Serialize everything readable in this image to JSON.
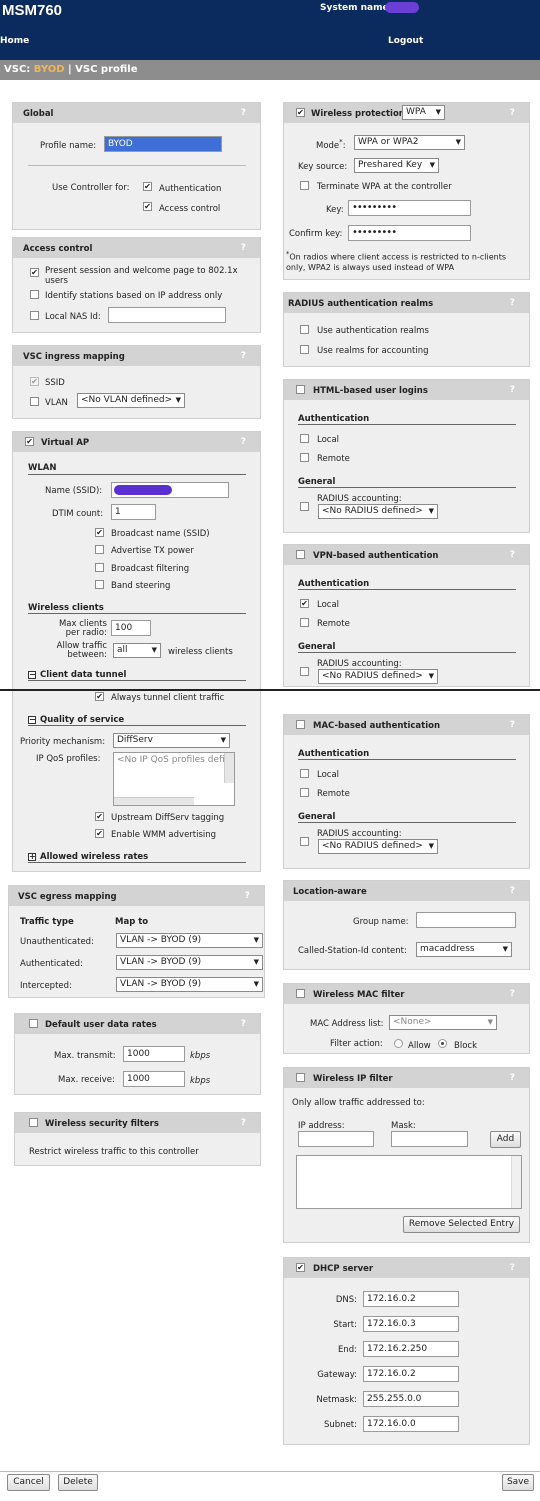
{
  "app": {
    "product": "MSM760",
    "system_name_label": "System name:"
  },
  "nav": {
    "home": "Home",
    "logout": "Logout"
  },
  "breadcrumb": {
    "prefix": "VSC: ",
    "vsc": "BYOD",
    "separator": " | ",
    "page": "VSC profile"
  },
  "global": {
    "title": "Global",
    "profile_name_label": "Profile name:",
    "profile_name": "BYOD",
    "use_controller_label": "Use Controller for:",
    "authentication": "Authentication",
    "access_control": "Access control"
  },
  "access_control": {
    "title": "Access control",
    "present_session": "Present session and welcome page to 802.1x users",
    "identify_stations": "Identify stations based on IP address only",
    "local_nas_id": "Local NAS Id:",
    "local_nas_value": ""
  },
  "ingress": {
    "title": "VSC ingress mapping",
    "ssid": "SSID",
    "vlan": "VLAN",
    "vlan_select": "<No VLAN defined>"
  },
  "virtual_ap": {
    "title": "Virtual AP",
    "wlan_heading": "WLAN",
    "name_label": "Name (SSID):",
    "dtim_label": "DTIM count:",
    "dtim_value": "1",
    "broadcast_name": "Broadcast name (SSID)",
    "advertise_tx": "Advertise TX power",
    "broadcast_filtering": "Broadcast filtering",
    "band_steering": "Band steering",
    "wireless_clients": "Wireless clients",
    "max_clients_label": "Max clients per radio:",
    "max_clients_value": "100",
    "allow_traffic_label": "Allow traffic between:",
    "allow_traffic_value": "all",
    "allow_traffic_suffix": "wireless clients",
    "client_data_tunnel": "Client data tunnel",
    "always_tunnel": "Always tunnel client traffic",
    "qos": "Quality of service",
    "priority_label": "Priority mechanism:",
    "priority_value": "DiffServ",
    "ip_qos_label": "IP QoS profiles:",
    "ip_qos_placeholder": "<No IP QoS profiles defi",
    "upstream_diffserv": "Upstream DiffServ tagging",
    "enable_wmm": "Enable WMM advertising",
    "allowed_rates": "Allowed wireless rates"
  },
  "egress": {
    "title": "VSC egress mapping",
    "traffic_type": "Traffic type",
    "map_to": "Map to",
    "rows": [
      {
        "label": "Unauthenticated:",
        "value": "VLAN -> BYOD (9)"
      },
      {
        "label": "Authenticated:",
        "value": "VLAN -> BYOD (9)"
      },
      {
        "label": "Intercepted:",
        "value": "VLAN -> BYOD (9)"
      }
    ]
  },
  "user_rates": {
    "title": "Default user data rates",
    "max_transmit": "Max. transmit:",
    "max_transmit_value": "1000",
    "max_receive": "Max. receive:",
    "max_receive_value": "1000",
    "unit": "kbps"
  },
  "sec_filters": {
    "title": "Wireless security filters",
    "desc": "Restrict wireless traffic to this controller"
  },
  "wireless_protection": {
    "title": "Wireless protection",
    "select": "WPA",
    "mode_label": "Mode",
    "mode_mark": "*",
    "mode_colon": ":",
    "mode_value": "WPA or WPA2",
    "key_source_label": "Key source:",
    "key_source_value": "Preshared Key",
    "terminate": "Terminate WPA at the controller",
    "key_label": "Key:",
    "key_value": "•••••••••",
    "confirm_label": "Confirm key:",
    "confirm_value": "•••••••••",
    "note_mark": "*",
    "note": "On radios where client access is restricted to n-clients only, WPA2 is always used instead of WPA"
  },
  "radius_realms": {
    "title": "RADIUS authentication realms",
    "use_auth": "Use authentication realms",
    "use_acct": "Use realms for accounting"
  },
  "html_logins": {
    "title": "HTML-based user logins",
    "authentication": "Authentication",
    "local": "Local",
    "remote": "Remote",
    "general": "General",
    "radius_accounting": "RADIUS accounting:",
    "radius_select": "<No RADIUS defined>"
  },
  "vpn_auth": {
    "title": "VPN-based authentication",
    "authentication": "Authentication",
    "local": "Local",
    "remote": "Remote",
    "general": "General",
    "radius_accounting": "RADIUS accounting:",
    "radius_select": "<No RADIUS defined>"
  },
  "mac_auth": {
    "title": "MAC-based authentication",
    "authentication": "Authentication",
    "local": "Local",
    "remote": "Remote",
    "general": "General",
    "radius_accounting": "RADIUS accounting:",
    "radius_select": "<No RADIUS defined>"
  },
  "location": {
    "title": "Location-aware",
    "group_name": "Group name:",
    "group_value": "",
    "called_station": "Called-Station-Id content:",
    "called_station_value": "macaddress"
  },
  "mac_filter": {
    "title": "Wireless MAC filter",
    "list_label": "MAC Address list:",
    "list_value": "<None>",
    "filter_action": "Filter action:",
    "allow": "Allow",
    "block": "Block"
  },
  "ip_filter": {
    "title": "Wireless IP filter",
    "desc": "Only allow traffic addressed to:",
    "ip_label": "IP address:",
    "mask_label": "Mask:",
    "add": "Add",
    "remove": "Remove Selected Entry"
  },
  "dhcp": {
    "title": "DHCP server",
    "rows": [
      {
        "label": "DNS:",
        "value": "172.16.0.2"
      },
      {
        "label": "Start:",
        "value": "172.16.0.3"
      },
      {
        "label": "End:",
        "value": "172.16.2.250"
      },
      {
        "label": "Gateway:",
        "value": "172.16.0.2"
      },
      {
        "label": "Netmask:",
        "value": "255.255.0.0"
      },
      {
        "label": "Subnet:",
        "value": "172.16.0.0"
      }
    ]
  },
  "footer": {
    "cancel": "Cancel",
    "delete": "Delete",
    "save": "Save"
  },
  "icons": {
    "help": "?",
    "check": "✔",
    "arrow": "▼",
    "collapse": "−",
    "expand": "+"
  },
  "colors": {
    "header_bg": "#0b2a5e",
    "breadcrumb_bg": "#8d8d8d",
    "breadcrumb_accent": "#f0b65a",
    "panel_bg": "#efefef",
    "panel_head": "#d3d3d3"
  }
}
